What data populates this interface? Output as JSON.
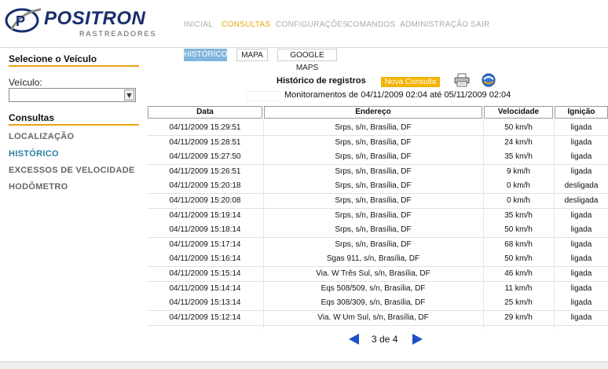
{
  "brand": {
    "name": "POSITRON",
    "sub": "RASTREADORES"
  },
  "nav": [
    {
      "label": "INICIAL",
      "active": false
    },
    {
      "label": "CONSULTAS",
      "active": true
    },
    {
      "label": "CONFIGURAÇÕES",
      "active": false
    },
    {
      "label": "COMANDOS",
      "active": false
    },
    {
      "label": "ADMINISTRAÇÃO",
      "active": false
    },
    {
      "label": "SAIR",
      "active": false
    }
  ],
  "sidebar": {
    "select_title": "Selecione o Veículo",
    "veiculo_label": "Veículo:",
    "veiculo_value": "",
    "consultas_title": "Consultas",
    "links": [
      {
        "label": "LOCALIZAÇÃO",
        "active": false
      },
      {
        "label": "HISTÓRICO",
        "active": true
      },
      {
        "label": "EXCESSOS DE VELOCIDADE",
        "active": false
      },
      {
        "label": "HODÔMETRO",
        "active": false
      }
    ]
  },
  "tabs": [
    {
      "label": "HISTÓRICO",
      "active": true
    },
    {
      "label": "MAPA",
      "active": false
    },
    {
      "label": "GOOGLE MAPS",
      "active": false
    }
  ],
  "main": {
    "title": "Histórico de registros",
    "nova_consulta": "Nova Consulta",
    "monitoramentos": "Monitoramentos de 04/11/2009 02:04 até 05/11/2009 02:04",
    "print_icon": "printer-icon",
    "refresh_icon": "refresh-globe-icon"
  },
  "table": {
    "headers": [
      "Data",
      "Endereço",
      "Velocidade",
      "Ignição"
    ],
    "rows": [
      [
        "04/11/2009 15:29:51",
        "Srps, s/n, Brasília, DF",
        "50 km/h",
        "ligada"
      ],
      [
        "04/11/2009 15:28:51",
        "Srps, s/n, Brasília, DF",
        "24 km/h",
        "ligada"
      ],
      [
        "04/11/2009 15:27:50",
        "Srps, s/n, Brasília, DF",
        "35 km/h",
        "ligada"
      ],
      [
        "04/11/2009 15:26:51",
        "Srps, s/n, Brasília, DF",
        "9 km/h",
        "ligada"
      ],
      [
        "04/11/2009 15:20:18",
        "Srps, s/n, Brasília, DF",
        "0 km/h",
        "desligada"
      ],
      [
        "04/11/2009 15:20:08",
        "Srps, s/n, Brasília, DF",
        "0 km/h",
        "desligada"
      ],
      [
        "04/11/2009 15:19:14",
        "Srps, s/n, Brasília, DF",
        "35 km/h",
        "ligada"
      ],
      [
        "04/11/2009 15:18:14",
        "Srps, s/n, Brasília, DF",
        "50 km/h",
        "ligada"
      ],
      [
        "04/11/2009 15:17:14",
        "Srps, s/n, Brasília, DF",
        "68 km/h",
        "ligada"
      ],
      [
        "04/11/2009 15:16:14",
        "Sgas 911, s/n, Brasília, DF",
        "50 km/h",
        "ligada"
      ],
      [
        "04/11/2009 15:15:14",
        "Via. W Três Sul, s/n, Brasília, DF",
        "46 km/h",
        "ligada"
      ],
      [
        "04/11/2009 15:14:14",
        "Eqs 508/509, s/n, Brasília, DF",
        "11 km/h",
        "ligada"
      ],
      [
        "04/11/2009 15:13:14",
        "Eqs 308/309, s/n, Brasília, DF",
        "25 km/h",
        "ligada"
      ],
      [
        "04/11/2009 15:12:14",
        "Via. W Um Sul, s/n, Brasília, DF",
        "29 km/h",
        "ligada"
      ]
    ]
  },
  "pager": {
    "text": "3 de 4"
  }
}
